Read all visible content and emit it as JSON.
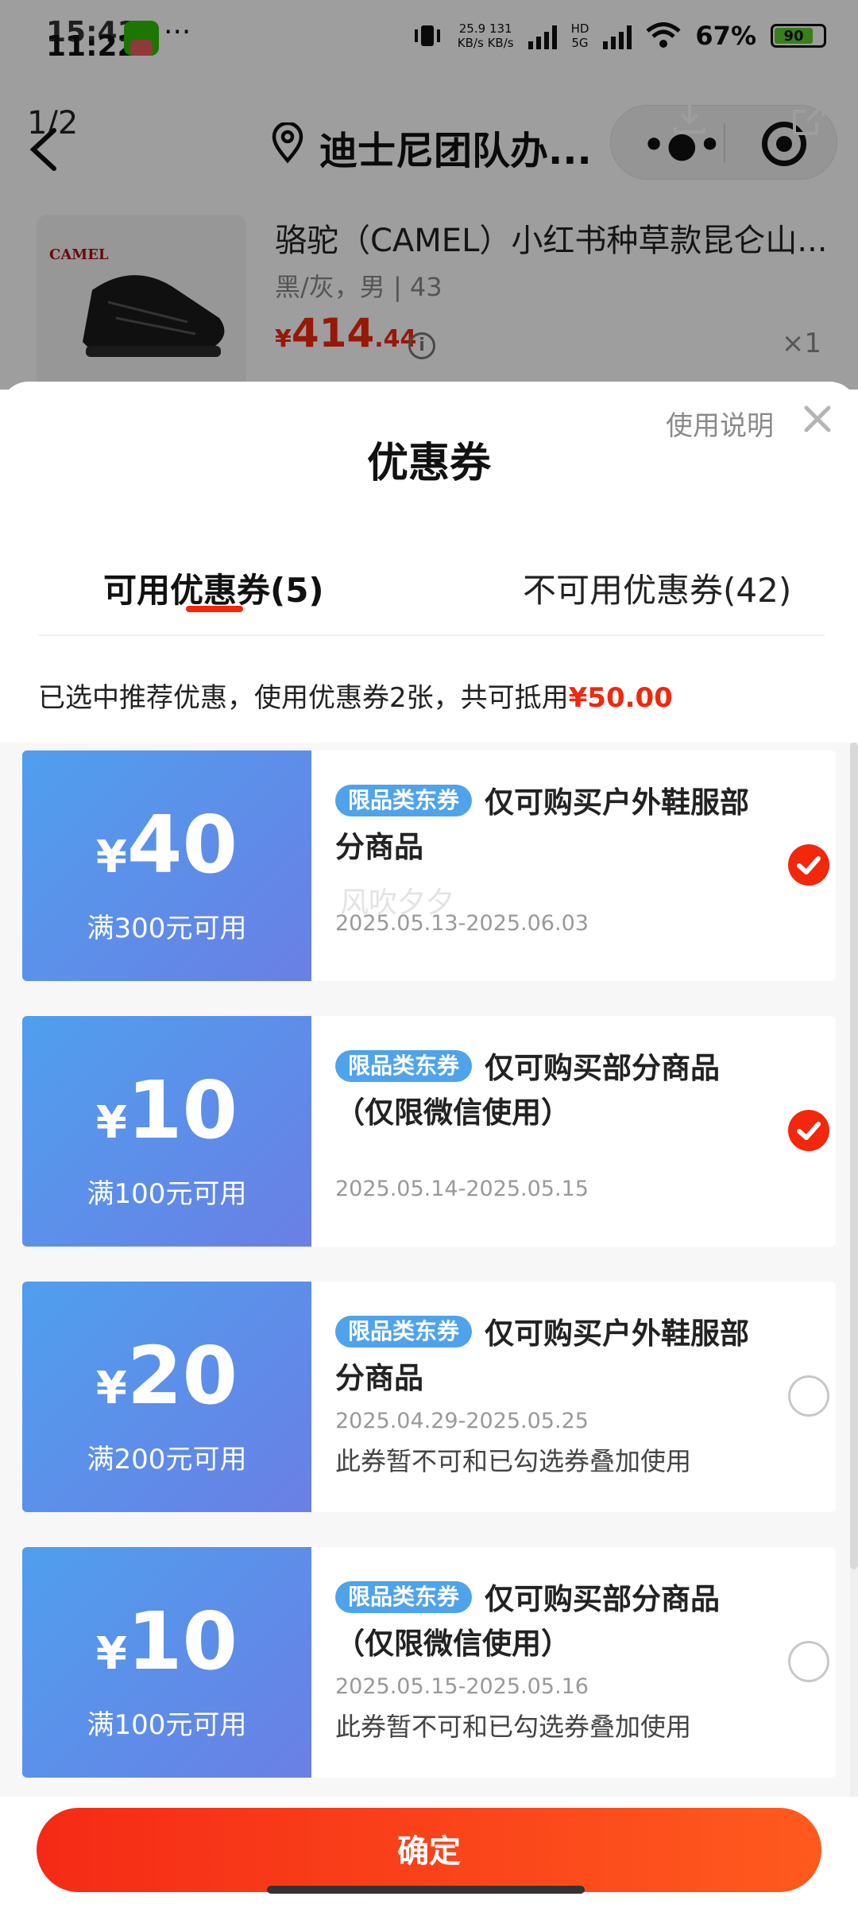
{
  "status_bar": {
    "time_overlay": "15:41",
    "time": "11:22",
    "menu_dots": "···",
    "net_speed": "25.9",
    "net_speed_unit": "KB/s",
    "net_speed2": "131",
    "net_speed2_unit": "KB/s",
    "hd_label": "HD",
    "network_type": "5G",
    "battery_percent_label": "67%",
    "battery_level_label": "90"
  },
  "nav": {
    "page_counter": "1/2",
    "title": "迪士尼团队办...",
    "more_icon": "more-dots-icon",
    "close_icon": "target-close-icon"
  },
  "product": {
    "brand": "CAMEL",
    "name": "骆驼（CAMEL）小红书种草款昆仑山...",
    "spec": "黑/灰，男 | 43",
    "price_symbol": "¥",
    "price_int": "414",
    "price_dec": ".44",
    "quantity": "×1"
  },
  "sheet": {
    "title": "优惠券",
    "help_label": "使用说明",
    "tabs": [
      {
        "label": "可用优惠券(5)",
        "active": true
      },
      {
        "label": "不可用优惠券(42)",
        "active": false
      }
    ],
    "summary_prefix": "已选中推荐优惠，使用优惠券2张，共可抵用",
    "summary_amount": "¥50.00",
    "confirm_label": "确定"
  },
  "coupons": [
    {
      "yen": "¥",
      "amount": "40",
      "condition": "满300元可用",
      "tag": "限品类东券",
      "title": "仅可购买户外鞋服部分商品",
      "date": "2025.05.13-2025.06.03",
      "note": "",
      "watermark": "风吹夕夕",
      "selected": true
    },
    {
      "yen": "¥",
      "amount": "10",
      "condition": "满100元可用",
      "tag": "限品类东券",
      "title": "仅可购买部分商品（仅限微信使用）",
      "date": "2025.05.14-2025.05.15",
      "note": "",
      "selected": true
    },
    {
      "yen": "¥",
      "amount": "20",
      "condition": "满200元可用",
      "tag": "限品类东券",
      "title": "仅可购买户外鞋服部分商品",
      "date": "2025.04.29-2025.05.25",
      "note": "此券暂不可和已勾选券叠加使用",
      "selected": false
    },
    {
      "yen": "¥",
      "amount": "10",
      "condition": "满100元可用",
      "tag": "限品类东券",
      "title": "仅可购买部分商品（仅限微信使用）",
      "date": "2025.05.15-2025.05.16",
      "note": "此券暂不可和已勾选券叠加使用",
      "selected": false
    }
  ],
  "colors": {
    "accent": "#f2270c",
    "coupon_blue": "#4f9fee",
    "tag_blue": "#4fa3ea"
  }
}
